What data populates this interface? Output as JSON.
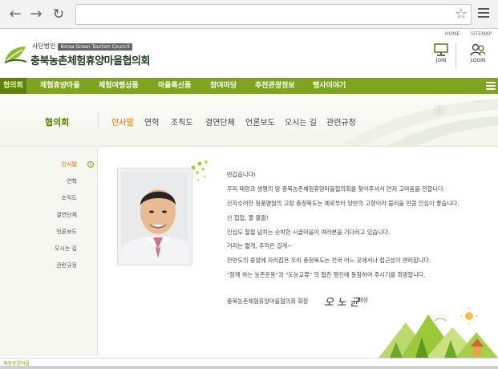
{
  "browser": {
    "back_icon": "arrow-left-icon",
    "forward_icon": "arrow-right-icon",
    "reload_icon": "reload-icon",
    "address_value": "",
    "star_icon": "star-icon",
    "menu_icon": "hamburger-icon"
  },
  "header": {
    "util_links": [
      "HOME",
      "SITEMAP"
    ],
    "logo_small": "사단법인",
    "logo_en": "Korea Green Tourism Council",
    "logo_title": "충북농촌체험휴양마을협의회",
    "join_label": "JOIN",
    "login_label": "LOGIN"
  },
  "gnb": {
    "items": [
      "협의회",
      "체험휴양마을",
      "체험여행상품",
      "마을특산품",
      "참여마당",
      "추천관광정보",
      "행사이야기"
    ],
    "active_index": 0
  },
  "sub": {
    "title": "협의회",
    "tabs": [
      "인사말",
      "연혁",
      "조직도",
      "결연단체",
      "언론보도",
      "오시는 길",
      "관련규정"
    ],
    "active_index": 0
  },
  "lnb": {
    "items": [
      "인사말",
      "연혁",
      "조직도",
      "결연단체",
      "언론보도",
      "오시는 길",
      "관련규정"
    ],
    "active_index": 0
  },
  "greeting": {
    "lines": [
      "반갑습니다!",
      "우리 태양과 생명의 땅 충북농촌체험휴양마을협의회를 찾아주셔서 먼저 고마움을 전합니다.",
      "산자수려한 청풍명월의 고장 충청북도는 예로부터 양반의 고향이라 불리울 만큼 인심이 좋습니다.",
      "산 첩첩, 물 콸콸!",
      "인심도 철철 넘치는 순박한 시골마을이 여러분을 기다리고 있습니다.",
      "거리는 짧게, 추억은 길게~",
      "한반도의 중앙에 자리잡은 우리 충청북도는 전국 어느 곳에서나 접근성이 편리합니다.",
      "\"함께 하는 농촌운동\"과 \"도농교류\" 의 협찬 행진에 동참하여 주시기를 희망합니다."
    ],
    "signature_org": "충북농촌체험휴양마을협의회 회장",
    "signature_name": "오 노 균",
    "signature_suffix": "배상"
  },
  "footer": {
    "text": "체험휴양마을"
  },
  "colors": {
    "brand_green": "#7ea31e",
    "active_orange": "#e06a00"
  }
}
